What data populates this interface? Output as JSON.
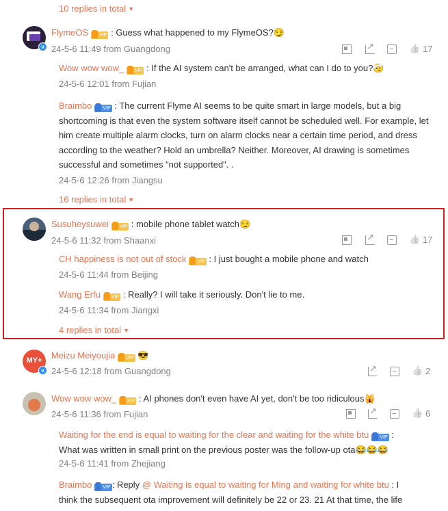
{
  "top_more": "10 replies in total",
  "c1": {
    "name": "FlymeOS",
    "text": ": Guess what happened to my FlymeOS?",
    "emoji": "😏",
    "meta": "24-5-6 11:49 from Guangdong",
    "likes": "17",
    "replies": [
      {
        "name": "Wow wow wow_",
        "text": ": If the AI system can't be arranged, what can I do to you?",
        "emoji": "🤕",
        "meta": "24-5-6 12:01 from Fujian"
      },
      {
        "name": "Braimbo",
        "text1": ": The current Flyme AI seems to be quite smart in large models, but a big",
        "text2": "shortcoming is that even the system software itself cannot be scheduled well. For example, let",
        "text3": "him create multiple alarm clocks, turn on alarm clocks near a certain time period, and dress",
        "text4": "according to the weather? Hold an umbrella? Neither. Moreover, AI drawing is sometimes",
        "text5": "successful and sometimes \"not supported\". .",
        "meta": "24-5-6 12:26 from Jiangsu"
      }
    ],
    "more": "16 replies in total"
  },
  "c2": {
    "name": "Susuheysuwei",
    "text": ": mobile phone tablet watch",
    "emoji": "😏",
    "meta": "24-5-6 11:32 from Shaanxi",
    "likes": "17",
    "replies": [
      {
        "name": "CH happiness is not out of stock",
        "text": ": I just bought a mobile phone and watch",
        "meta": "24-5-6 11:44 from Beijing"
      },
      {
        "name": "Wang Erfu",
        "text": ": Really? I will take it seriously. Don't lie to me.",
        "meta": "24-5-6 11:34 from Jiangxi"
      }
    ],
    "more": "4 replies in total"
  },
  "c3": {
    "name": "Meizu Meiyoujia",
    "emoji": "😎",
    "meta": "24-5-6 12:18 from Guangdong",
    "likes": "2",
    "avatar_text": "MY+"
  },
  "c4": {
    "name": "Wow wow wow_",
    "text": ": AI phones don't even have AI yet, don't be too ridiculous",
    "emoji": "🙀",
    "meta": "24-5-6 11:36 from Fujian",
    "likes": "6",
    "replies": [
      {
        "name": "Waiting for the end is equal to waiting for the clear and waiting for the white btu",
        "text_after": ":",
        "text2": "What was written in small print on the previous poster was the follow-up ota",
        "emoji": "😂😂😂",
        "meta": "24-5-6 11:41 from Zhejiang"
      },
      {
        "name": "Braimbo",
        "text_pre": ": Reply ",
        "at": "@ Waiting is equal to waiting for Ming and waiting for white btu",
        "text_post": ": I",
        "text2": "think the subsequent ota improvement will definitely be 22 or 23. 21 At that time, the life"
      }
    ]
  },
  "colors": {
    "accent": "#eb7350",
    "highlight": "#d91c1c",
    "muted": "#808080"
  }
}
